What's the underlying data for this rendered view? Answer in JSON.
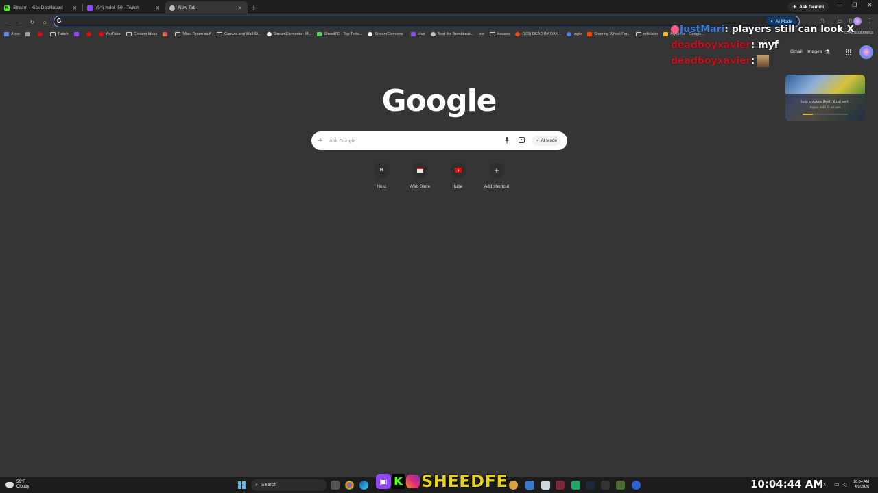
{
  "tabs": [
    {
      "title": "Stream - Kick Dashboard",
      "favicon": "kick-icon",
      "active": false
    },
    {
      "title": "(54) mdot_59 - Twitch",
      "favicon": "twitch-icon",
      "active": false
    },
    {
      "title": "New Tab",
      "favicon": "chrome-icon",
      "active": true
    }
  ],
  "tab_close_glyph": "✕",
  "new_tab_glyph": "+",
  "ask_gemini": "Ask Gemini",
  "omnibox": {
    "value": "",
    "ai_mode_label": "AI Mode"
  },
  "bookmarks": [
    {
      "label": "Apps",
      "icon": "apps-grid-icon"
    },
    {
      "label": "",
      "icon": "youtube-icon"
    },
    {
      "label": "Twitch",
      "icon": "folder-icon"
    },
    {
      "label": "",
      "icon": "twitch-icon"
    },
    {
      "label": "YouTube",
      "icon": "youtube-icon"
    },
    {
      "label": "Content Ideas",
      "icon": "folder-icon"
    },
    {
      "label": "",
      "icon": "instagram-icon"
    },
    {
      "label": "Misc. Room stuff",
      "icon": "folder-icon"
    },
    {
      "label": "Canvas and Wall St...",
      "icon": "folder-icon"
    },
    {
      "label": "StreamElements - M...",
      "icon": "streamelements-icon"
    },
    {
      "label": "SheedFE - Top Twitc...",
      "icon": "sheedfe-icon"
    },
    {
      "label": "StreamElements -",
      "icon": "streamelements-icon"
    },
    {
      "label": "chat",
      "icon": "twitch-icon"
    },
    {
      "label": "Beat the Bombbeat...",
      "icon": "globe-icon"
    },
    {
      "label": "oor",
      "icon": "none"
    },
    {
      "label": "houses",
      "icon": "folder-icon"
    },
    {
      "label": "(103) DEAD BY DAN...",
      "icon": "reddit-icon"
    },
    {
      "label": "ingle",
      "icon": "link-icon"
    },
    {
      "label": "Steering Wheel For...",
      "icon": "shield-icon"
    },
    {
      "label": "edit later",
      "icon": "folder-icon"
    },
    {
      "label": "My Drive - Google...",
      "icon": "drive-icon"
    }
  ],
  "all_bookmarks": "All Bookmarks",
  "ntp": {
    "gmail": "Gmail",
    "images": "Images",
    "logo": "Google",
    "search_placeholder": "Ask Google",
    "ai_mode": "AI Mode",
    "shortcuts": [
      {
        "label": "Hulu",
        "badge": "H"
      },
      {
        "label": "Web Store",
        "badge": ""
      },
      {
        "label": "tube",
        "badge": ""
      },
      {
        "label": "Add shortcut",
        "badge": "+"
      }
    ]
  },
  "overlay": {
    "chat": [
      {
        "user": "JustMari",
        "message": ": players still can look X",
        "user_color": "#3a7bd5"
      },
      {
        "user": "deadboyxavier",
        "message": ": myf",
        "user_color": "#c1121f"
      },
      {
        "user": "deadboyxavier",
        "message": ":",
        "user_color": "#c1121f"
      }
    ],
    "now_playing": {
      "title": "holy smokes (feat. lil uzi vert)",
      "artist": "trippie redd, lil uzi vert",
      "progress": 0.22
    },
    "brand": "SHEEDFE"
  },
  "taskbar": {
    "weather_temp": "56°F",
    "weather_desc": "Cloudy",
    "search_label": "Search",
    "clock_overlay": "10:04:44 AM",
    "time": "10:04 AM",
    "date": "4/9/2026"
  },
  "colors": {
    "accent": "#7cacf8",
    "page_bg": "#353535",
    "tabstrip_bg": "#1f1f1f"
  }
}
